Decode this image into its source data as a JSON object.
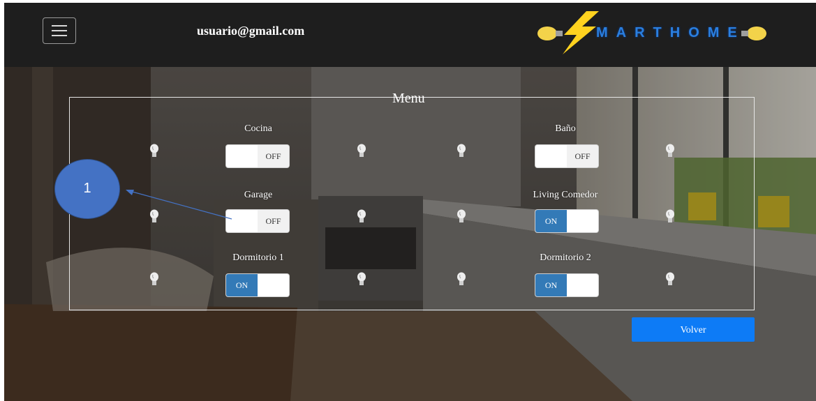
{
  "header": {
    "user_email": "usuario@gmail.com",
    "logo_text": "MARTHOME"
  },
  "menu": {
    "title": "Menu",
    "rooms": [
      {
        "name": "Cocina",
        "state": "OFF"
      },
      {
        "name": "Baño",
        "state": "OFF"
      },
      {
        "name": "Garage",
        "state": "OFF"
      },
      {
        "name": "Living Comedor",
        "state": "ON"
      },
      {
        "name": "Dormitorio 1",
        "state": "ON"
      },
      {
        "name": "Dormitorio 2",
        "state": "ON"
      }
    ]
  },
  "actions": {
    "back_label": "Volver"
  },
  "annotation": {
    "label": "1"
  },
  "colors": {
    "navbar": "#1e1e1e",
    "toggle_on": "#337ab7",
    "button_primary": "#0d7bf6",
    "annotation": "#4472c4"
  },
  "icons": [
    "menu-icon",
    "lightbulb-icon",
    "lightning-bolt-icon"
  ]
}
